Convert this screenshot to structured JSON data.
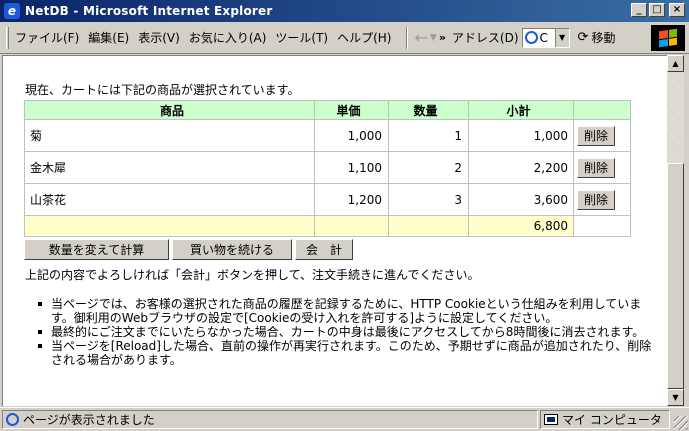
{
  "window": {
    "title": "NetDB - Microsoft Internet Explorer",
    "app_icon": "e",
    "controls": {
      "minimize": "_",
      "maximize": "□",
      "close": "×"
    }
  },
  "menubar": {
    "items": [
      "ファイル(F)",
      "編集(E)",
      "表示(V)",
      "お気に入り(A)",
      "ツール(T)",
      "ヘルプ(H)"
    ],
    "back_icon": "←",
    "back_dropdown": "▼",
    "chevron": "»",
    "address_label": "アドレス(D)",
    "address_value": "C",
    "address_dropdown": "▼",
    "go_icon": "⟳",
    "go_label": "移動"
  },
  "page": {
    "lead": "現在、カートには下記の商品が選択されています。",
    "table": {
      "headers": [
        "商品",
        "単価",
        "数量",
        "小計"
      ],
      "rows": [
        {
          "name": "菊",
          "price": "1,000",
          "qty": "1",
          "subtotal": "1,000",
          "delete": "削除"
        },
        {
          "name": "金木犀",
          "price": "1,100",
          "qty": "2",
          "subtotal": "2,200",
          "delete": "削除"
        },
        {
          "name": "山茶花",
          "price": "1,200",
          "qty": "3",
          "subtotal": "3,600",
          "delete": "削除"
        }
      ],
      "total": "6,800"
    },
    "buttons": {
      "recalc": "数量を変えて計算",
      "continue": "買い物を続ける",
      "checkout": "会　計"
    },
    "instruction": "上記の内容でよろしければ「会計」ボタンを押して、注文手続きに進んでください。",
    "notes": [
      "当ページでは、お客様の選択された商品の履歴を記録するために、HTTP Cookieという仕組みを利用しています。御利用のWebブラウザの設定で[Cookieの受け入れを許可する]ように設定してください。",
      "最終的にご注文までにいたらなかった場合、カートの中身は最後にアクセスしてから8時間後に消去されます。",
      "当ページを[Reload]した場合、直前の操作が再実行されます。このため、予期せずに商品が追加されたり、削除される場合があります。"
    ]
  },
  "statusbar": {
    "message": "ページが表示されました",
    "zone": "マイ コンピュータ"
  },
  "scrollbar": {
    "up": "▲",
    "down": "▼"
  }
}
